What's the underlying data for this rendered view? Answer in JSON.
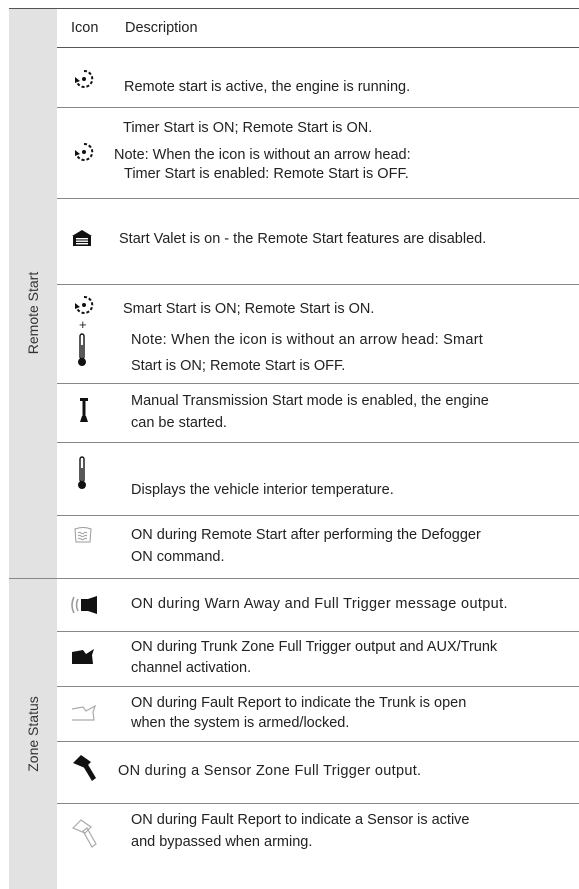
{
  "header": {
    "icon_col": "Icon",
    "description_col": "Description"
  },
  "sections": {
    "remote_start": {
      "label": "Remote Start"
    },
    "zone_status": {
      "label": "Zone Status"
    }
  },
  "rows": {
    "r1": {
      "text": "Remote start is active, the engine is running."
    },
    "r2": {
      "line1": "Timer Start is ON; Remote Start is ON.",
      "line2": "Note: When the icon is without an arrow head:",
      "line3": "Timer Start is enabled: Remote Start is OFF."
    },
    "r3": {
      "text": "Start Valet is on - the Remote Start features are disabled."
    },
    "r4": {
      "line1": "Smart Start is ON; Remote Start is ON.",
      "line2": "Note: When the icon is without an arrow head: Smart",
      "line3": "Start is ON; Remote Start is OFF.",
      "plus": "+"
    },
    "r5": {
      "line1": "Manual Transmission Start mode is enabled, the engine",
      "line2": "can be started."
    },
    "r6": {
      "text": "Displays the vehicle interior temperature."
    },
    "r7": {
      "line1": "ON during Remote Start after performing the  Defogger",
      "line2": "ON command."
    },
    "z1": {
      "text": "ON during Warn Away and Full Trigger message output."
    },
    "z2": {
      "line1": "ON during Trunk Zone Full Trigger output and AUX/Trunk",
      "line2": "channel activation."
    },
    "z3": {
      "line1": "ON during Fault Report to indicate the Trunk is open",
      "line2": "when the system is armed/locked."
    },
    "z4": {
      "text": "ON during a Sensor Zone Full Trigger output."
    },
    "z5": {
      "line1": "ON during Fault Report to indicate a Sensor is active",
      "line2": "and bypassed when arming."
    }
  },
  "icons": {
    "r1": "remote-start-arrow-icon",
    "r2": "timer-start-arrow-icon",
    "r3": "valet-garage-icon",
    "r4": "smart-start-arrow-icon",
    "r5": "manual-transmission-icon",
    "r6": "thermometer-icon",
    "r7": "defogger-icon",
    "z1": "warn-away-icon",
    "z2": "trunk-open-filled-icon",
    "z3": "trunk-open-outline-icon",
    "z4": "hammer-filled-icon",
    "z5": "hammer-outline-icon"
  }
}
